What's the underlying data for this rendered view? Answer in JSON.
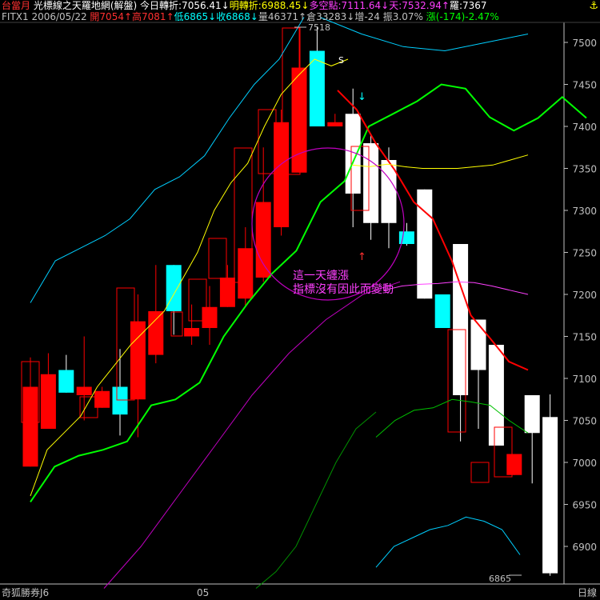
{
  "header": {
    "row1": [
      {
        "text": "台當月",
        "color": "#ff3030"
      },
      {
        "text": " 光標線之天羅地網(解盤) ",
        "color": "#ffffff"
      },
      {
        "text": "今日轉折:7056.41↓",
        "color": "#ffffff"
      },
      {
        "text": "明轉折:6988.45↓",
        "color": "#ffff00"
      },
      {
        "text": "多空點:7111.64↓",
        "color": "#ff40ff"
      },
      {
        "text": "天:7532.94↑",
        "color": "#ff40ff"
      },
      {
        "text": "羅:7367",
        "color": "#ffffff"
      }
    ],
    "row2": [
      {
        "text": "FITX1 2006/05/22 ",
        "color": "#c0c0c0"
      },
      {
        "text": "開7054↑",
        "color": "#ff3030"
      },
      {
        "text": "高7081↑",
        "color": "#ff3030"
      },
      {
        "text": "低6865↓",
        "color": "#00ffff"
      },
      {
        "text": "收6868↓",
        "color": "#00ffff"
      },
      {
        "text": "量46371↑",
        "color": "#c0c0c0"
      },
      {
        "text": "倉33283↓",
        "color": "#c0c0c0"
      },
      {
        "text": "增-24 ",
        "color": "#c0c0c0"
      },
      {
        "text": "振3.07% ",
        "color": "#c0c0c0"
      },
      {
        "text": "漲(-174)-2.47%",
        "color": "#00ff00"
      }
    ],
    "corner_icon": "anchor-icon"
  },
  "footer": {
    "left": "奇狐勝券J6",
    "month_label": "05",
    "period": "日線"
  },
  "colors": {
    "up": "#ff0000",
    "down_white": "#ffffff",
    "down_cyan": "#00ffff",
    "axis": "#c0c0c0"
  },
  "chart_data": {
    "type": "candlestick",
    "ylim": [
      6865,
      7530
    ],
    "yticks": [
      6900,
      6950,
      7000,
      7050,
      7100,
      7150,
      7200,
      7250,
      7300,
      7350,
      7400,
      7450,
      7500
    ],
    "annotations": {
      "max_label": "7518",
      "min_label": "6865",
      "note_lines": [
        "這一天纏漲",
        "指標沒有因此而變動"
      ],
      "s_label": "S"
    },
    "candles": [
      {
        "o": 6995,
        "h": 7125,
        "l": 6995,
        "c": 7090,
        "col": "up"
      },
      {
        "o": 7040,
        "h": 7130,
        "l": 7040,
        "c": 7105,
        "col": "up"
      },
      {
        "o": 7110,
        "h": 7128,
        "l": 7083,
        "c": 7083,
        "col": "cyan"
      },
      {
        "o": 7080,
        "h": 7150,
        "l": 7050,
        "c": 7090,
        "col": "up"
      },
      {
        "o": 7065,
        "h": 7090,
        "l": 7065,
        "c": 7085,
        "col": "up"
      },
      {
        "o": 7090,
        "h": 7135,
        "l": 7032,
        "c": 7057,
        "col": "cyan"
      },
      {
        "o": 7075,
        "h": 7200,
        "l": 7030,
        "c": 7168,
        "col": "up"
      },
      {
        "o": 7128,
        "h": 7235,
        "l": 7118,
        "c": 7180,
        "col": "up"
      },
      {
        "o": 7235,
        "h": 7235,
        "l": 7152,
        "c": 7180,
        "col": "cyan"
      },
      {
        "o": 7150,
        "h": 7188,
        "l": 7140,
        "c": 7160,
        "col": "up"
      },
      {
        "o": 7160,
        "h": 7210,
        "l": 7140,
        "c": 7185,
        "col": "up"
      },
      {
        "o": 7185,
        "h": 7235,
        "l": 7185,
        "c": 7220,
        "col": "up"
      },
      {
        "o": 7195,
        "h": 7280,
        "l": 7185,
        "c": 7255,
        "col": "up"
      },
      {
        "o": 7220,
        "h": 7375,
        "l": 7215,
        "c": 7310,
        "col": "up"
      },
      {
        "o": 7280,
        "h": 7420,
        "l": 7270,
        "c": 7405,
        "col": "up"
      },
      {
        "o": 7345,
        "h": 7518,
        "l": 7345,
        "c": 7470,
        "col": "up"
      },
      {
        "o": 7490,
        "h": 7518,
        "l": 7400,
        "c": 7400,
        "col": "cyan"
      },
      {
        "o": 7400,
        "h": 7415,
        "l": 7400,
        "c": 7405,
        "col": "up"
      },
      {
        "o": 7415,
        "h": 7445,
        "l": 7280,
        "c": 7320,
        "col": "white"
      },
      {
        "o": 7380,
        "h": 7390,
        "l": 7265,
        "c": 7285,
        "col": "white"
      },
      {
        "o": 7360,
        "h": 7375,
        "l": 7255,
        "c": 7285,
        "col": "white"
      },
      {
        "o": 7275,
        "h": 7285,
        "l": 7258,
        "c": 7260,
        "col": "cyan"
      },
      {
        "o": 7325,
        "h": 7325,
        "l": 7195,
        "c": 7195,
        "col": "white"
      },
      {
        "o": 7200,
        "h": 7200,
        "l": 7160,
        "c": 7160,
        "col": "cyan"
      },
      {
        "o": 7260,
        "h": 7260,
        "l": 7025,
        "c": 7080,
        "col": "white"
      },
      {
        "o": 7170,
        "h": 7170,
        "l": 7040,
        "c": 7110,
        "col": "white"
      },
      {
        "o": 7140,
        "h": 7140,
        "l": 7020,
        "c": 7020,
        "col": "white"
      },
      {
        "o": 6985,
        "h": 7010,
        "l": 6985,
        "c": 7010,
        "col": "up"
      },
      {
        "o": 7080,
        "h": 7080,
        "l": 6975,
        "c": 7035,
        "col": "white"
      },
      {
        "o": 7054,
        "h": 7081,
        "l": 6865,
        "c": 6868,
        "col": "white"
      }
    ],
    "lines": [
      {
        "name": "",
        "color": "#00ff00",
        "width": 2,
        "values": [
          6953,
          6995,
          7008,
          7015,
          7025,
          7068,
          7075,
          7095,
          7150,
          7190,
          7225,
          7252,
          7310,
          7335,
          7400,
          7415,
          7430,
          7450,
          7445,
          7411,
          7395,
          7410,
          7435,
          7410
        ]
      },
      {
        "name": "",
        "color": "#ffff00",
        "width": 1,
        "values": [
          6960,
          7015,
          7035,
          7055,
          7090,
          7115,
          7140,
          7160,
          7180,
          7215,
          7250,
          7300,
          7333,
          7356,
          7400,
          7438,
          7460,
          7480,
          7472,
          7480
        ]
      },
      {
        "name": "",
        "color": "#ff0000",
        "width": 2,
        "values": [
          7443,
          7420,
          7380,
          7348,
          7310,
          7290,
          7240,
          7175,
          7148,
          7120,
          7110
        ]
      },
      {
        "name": "",
        "color": "#ffff00",
        "width": 1,
        "values": [
          7354,
          7352,
          7355,
          7352,
          7350,
          7350,
          7350,
          7352,
          7354,
          7360,
          7366
        ]
      },
      {
        "name": "",
        "color": "#ff40ff",
        "width": 1,
        "values": [
          7205,
          7210,
          7212,
          7213,
          7215,
          7214,
          7210,
          7205,
          7200
        ]
      },
      {
        "name": "",
        "color": "#00c000",
        "width": 1,
        "values": [
          7030,
          7050,
          7062,
          7065,
          7075,
          7072,
          7068,
          7050,
          7035
        ]
      },
      {
        "name": "",
        "color": "#00cfff",
        "width": 1,
        "values": [
          7190,
          7240,
          7255,
          7270,
          7290,
          7325,
          7340,
          7365,
          7410,
          7450,
          7480,
          7530
        ]
      },
      {
        "name": "",
        "color": "#00cfff",
        "width": 1,
        "values": [
          7530,
          7510,
          7495,
          7490,
          7500,
          7510
        ]
      },
      {
        "name": "",
        "color": "#00cfff",
        "width": 1,
        "values": [
          6875,
          6900,
          6910,
          6920,
          6925,
          6935,
          6930,
          6920,
          6890
        ]
      },
      {
        "name": "",
        "color": "#c000c0",
        "width": 1,
        "values": [
          6850,
          6900,
          6960,
          7020,
          7080,
          7130,
          7170,
          7200,
          7215
        ]
      },
      {
        "name": "",
        "color": "#009000",
        "width": 1,
        "values": [
          6850,
          6870,
          6900,
          6950,
          7000,
          7040,
          7060
        ]
      }
    ]
  }
}
